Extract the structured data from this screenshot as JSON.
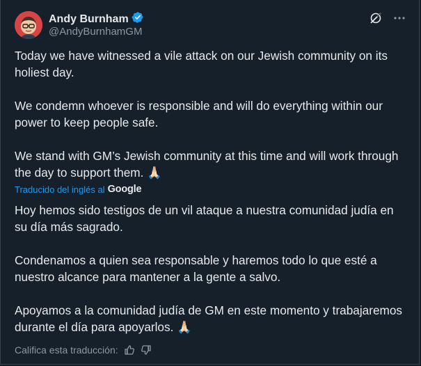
{
  "author": {
    "name": "Andy Burnham",
    "handle": "@AndyBurnhamGM",
    "verified": true,
    "verified_color": "#1d9bf0"
  },
  "icons": {
    "grok": "grok-icon",
    "more": "more-icon"
  },
  "original_text": [
    "Today we have witnessed a vile attack on our Jewish community on its holiest day.",
    "We condemn whoever is responsible and will do everything within our power to keep people safe.",
    "We stand with GM’s Jewish community at this time and will work through the day to support them. 🙏🏻"
  ],
  "translation": {
    "label": "Traducido del inglés al",
    "provider": "Google",
    "text": [
      "Hoy hemos sido testigos de un vil ataque a nuestra comunidad judía en su día más sagrado.",
      "Condenamos a quien sea responsable y haremos todo lo que esté a nuestro alcance para mantener a la gente a salvo.",
      "Apoyamos a la comunidad judía de GM en este momento y trabajaremos durante el día para apoyarlos. 🙏🏻"
    ],
    "rate_label": "Califica esta traducción:"
  },
  "colors": {
    "background": "#15202b",
    "text": "#e7e9ea",
    "secondary": "#8b98a5",
    "link": "#1d9bf0"
  }
}
